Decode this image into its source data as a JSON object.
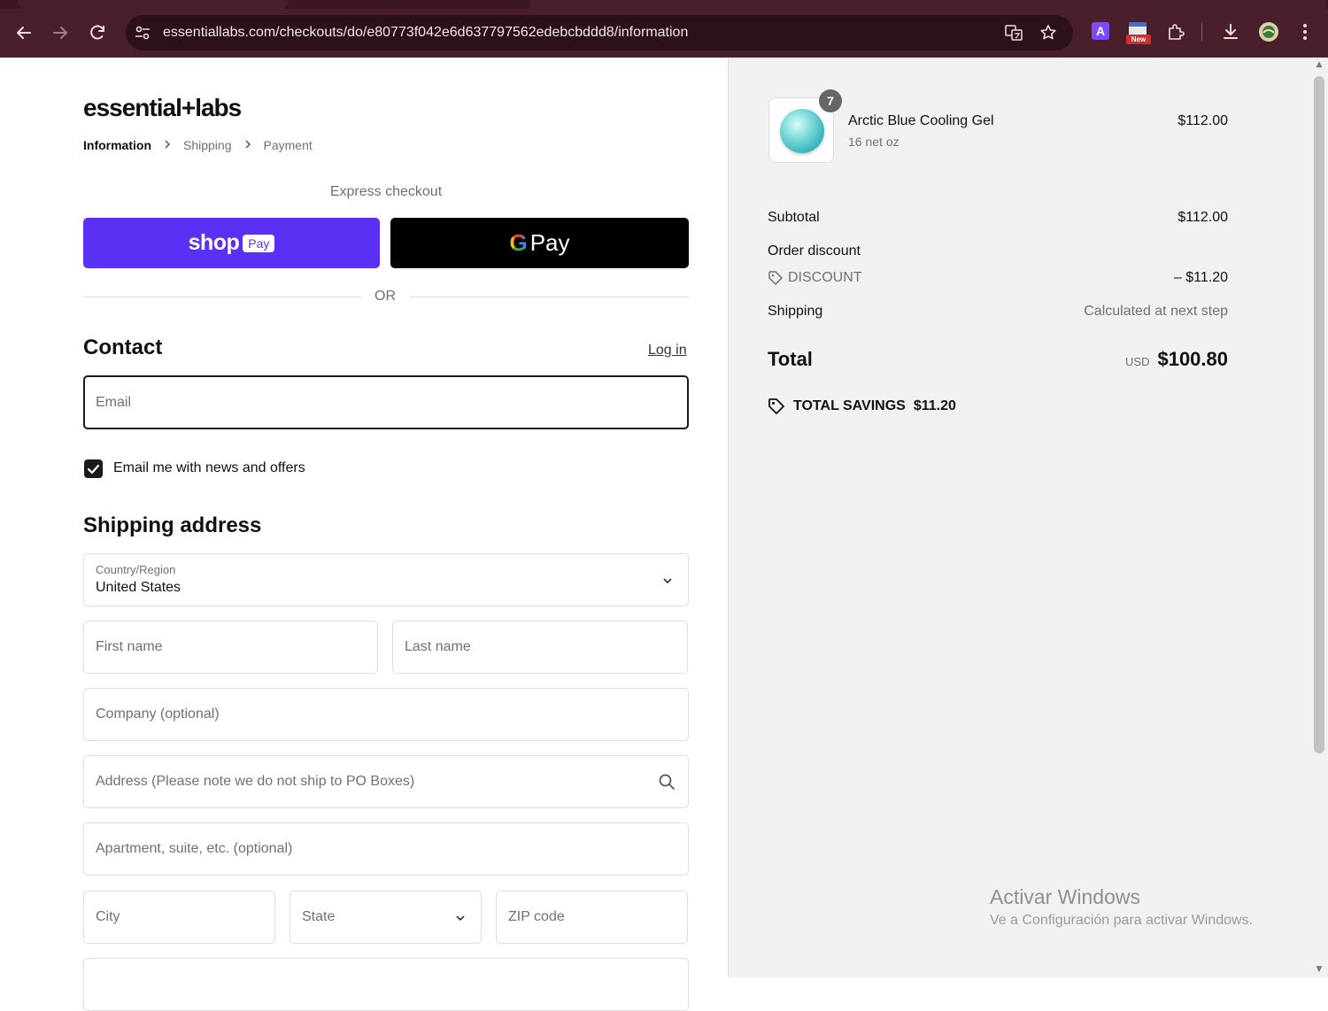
{
  "browser": {
    "url": "essentiallabs.com/checkouts/do/e80773f042e6d637797562edebcbddd8/information",
    "new_badge": "New"
  },
  "store": {
    "logo": "essential+labs"
  },
  "breadcrumb": [
    "Information",
    "Shipping",
    "Payment"
  ],
  "express": {
    "title": "Express checkout",
    "shop_label": "shop",
    "shop_pay_label": "Pay",
    "gpay_g": "G",
    "gpay_label": "Pay",
    "or_label": "OR"
  },
  "contact": {
    "heading": "Contact",
    "login_label": "Log in",
    "email_placeholder": "Email",
    "newsletter_label": "Email me with news and offers",
    "newsletter_checked": true
  },
  "shipping": {
    "heading": "Shipping address",
    "country_label": "Country/Region",
    "country_value": "United States",
    "first_name_placeholder": "First name",
    "last_name_placeholder": "Last name",
    "company_placeholder": "Company (optional)",
    "address_placeholder": "Address (Please note we do not ship to PO Boxes)",
    "apartment_placeholder": "Apartment, suite, etc. (optional)",
    "city_placeholder": "City",
    "state_placeholder": "State",
    "zip_placeholder": "ZIP code"
  },
  "summary": {
    "item": {
      "quantity": "7",
      "name": "Arctic Blue Cooling Gel",
      "variant": "16 net oz",
      "price": "$112.00"
    },
    "subtotal_label": "Subtotal",
    "subtotal_value": "$112.00",
    "discount_heading": "Order discount",
    "discount_code": "DISCOUNT",
    "discount_value": "– $11.20",
    "shipping_label": "Shipping",
    "shipping_value": "Calculated at next step",
    "total_label": "Total",
    "currency": "USD",
    "total_value": "$100.80",
    "savings_label": "TOTAL SAVINGS",
    "savings_value": "$11.20"
  },
  "watermark": {
    "line1": "Activar Windows",
    "line2": "Ve a Configuración para activar Windows."
  }
}
